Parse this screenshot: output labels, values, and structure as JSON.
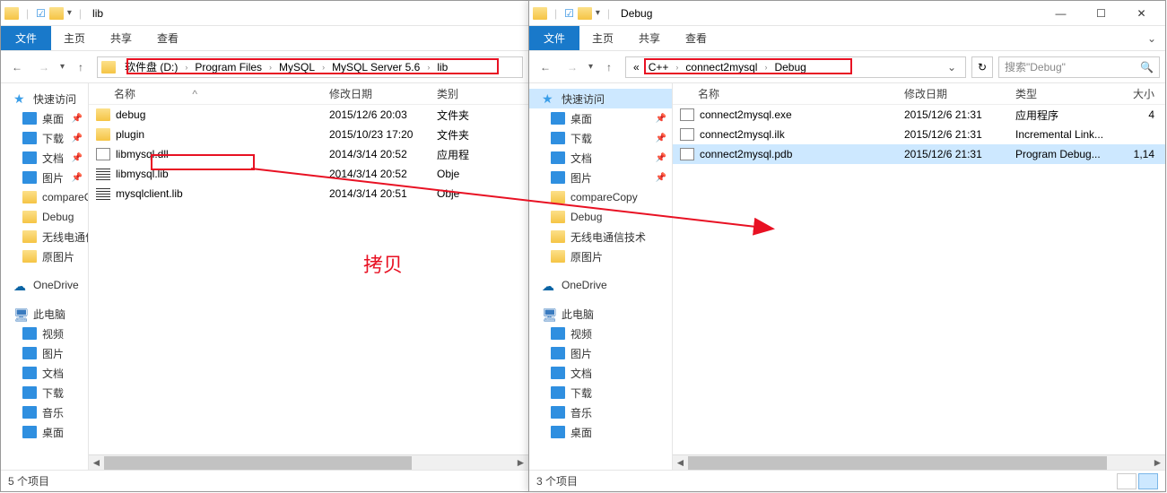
{
  "left": {
    "title": "lib",
    "ribbon": {
      "file": "文件",
      "home": "主页",
      "share": "共享",
      "view": "查看"
    },
    "breadcrumb": [
      "软件盘 (D:)",
      "Program Files",
      "MySQL",
      "MySQL Server 5.6",
      "lib"
    ],
    "columns": {
      "name": "名称",
      "date": "修改日期",
      "type": "类别"
    },
    "files": [
      {
        "icon": "folder",
        "name": "debug",
        "date": "2015/12/6 20:03",
        "type": "文件夹"
      },
      {
        "icon": "folder",
        "name": "plugin",
        "date": "2015/10/23 17:20",
        "type": "文件夹"
      },
      {
        "icon": "dll",
        "name": "libmysql.dll",
        "date": "2014/3/14 20:52",
        "type": "应用程"
      },
      {
        "icon": "lib",
        "name": "libmysql.lib",
        "date": "2014/3/14 20:52",
        "type": "Obje"
      },
      {
        "icon": "lib",
        "name": "mysqlclient.lib",
        "date": "2014/3/14 20:51",
        "type": "Obje"
      }
    ],
    "status": "5 个项目"
  },
  "right": {
    "title": "Debug",
    "ribbon": {
      "file": "文件",
      "home": "主页",
      "share": "共享",
      "view": "查看"
    },
    "breadcrumb_prefix": "«",
    "breadcrumb": [
      "C++",
      "connect2mysql",
      "Debug"
    ],
    "search_placeholder": "搜索\"Debug\"",
    "columns": {
      "name": "名称",
      "date": "修改日期",
      "type": "类型",
      "size": "大小"
    },
    "files": [
      {
        "icon": "exe",
        "name": "connect2mysql.exe",
        "date": "2015/12/6 21:31",
        "type": "应用程序",
        "size": "4"
      },
      {
        "icon": "dll",
        "name": "connect2mysql.ilk",
        "date": "2015/12/6 21:31",
        "type": "Incremental Link...",
        "size": ""
      },
      {
        "icon": "dll",
        "name": "connect2mysql.pdb",
        "date": "2015/12/6 21:31",
        "type": "Program Debug...",
        "size": "1,14",
        "selected": true
      }
    ],
    "status": "3 个项目"
  },
  "sidebar": {
    "quick": "快速访问",
    "items_quick": [
      "桌面",
      "下载",
      "文档",
      "图片"
    ],
    "folders": [
      "compareCopyC",
      "Debug",
      "无线电通信技术",
      "原图片"
    ],
    "folders_r": [
      "compareCopy",
      "Debug",
      "无线电通信技术",
      "原图片"
    ],
    "onedrive": "OneDrive",
    "thispc": "此电脑",
    "pc_subs": [
      "视频",
      "图片",
      "文档",
      "下载",
      "音乐",
      "桌面"
    ]
  },
  "annotation": "拷贝"
}
